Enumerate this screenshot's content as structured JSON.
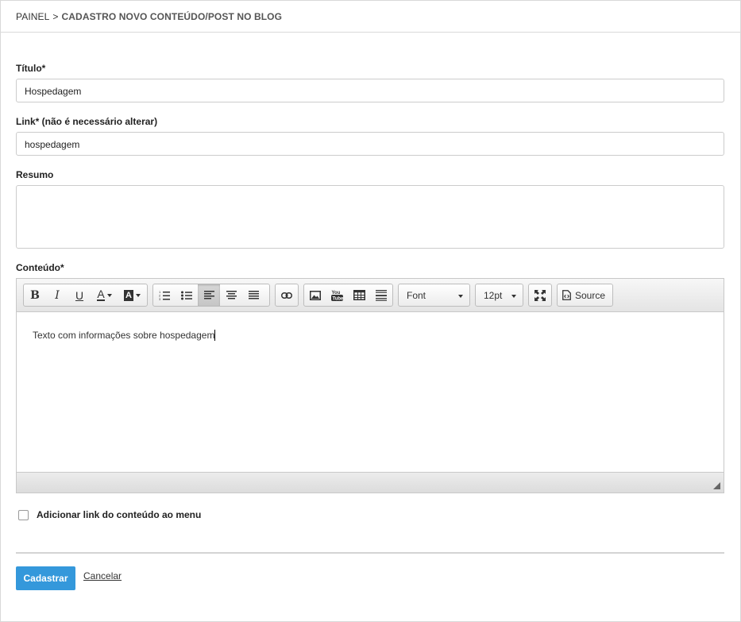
{
  "breadcrumb": {
    "root": "PAINEL",
    "separator": ">",
    "current": "CADASTRO NOVO CONTEÚDO/POST NO BLOG"
  },
  "form": {
    "title_label": "Título*",
    "title_value": "Hospedagem",
    "link_label": "Link* (não é necessário alterar)",
    "link_value": "hospedagem",
    "summary_label": "Resumo",
    "summary_value": "",
    "content_label": "Conteúdo*",
    "content_value": "Texto com informações sobre hospedagem",
    "menu_checkbox_label": "Adicionar link do conteúdo ao menu",
    "menu_checkbox_checked": false,
    "submit_label": "Cadastrar",
    "cancel_label": "Cancelar"
  },
  "editor": {
    "font_dropdown": "Font",
    "size_dropdown": "12pt",
    "source_label": "Source",
    "toolbar_icons": [
      "bold-icon",
      "italic-icon",
      "underline-icon",
      "font-color-icon",
      "background-color-icon",
      "ordered-list-icon",
      "unordered-list-icon",
      "align-left-icon",
      "align-center-icon",
      "justify-icon",
      "link-icon",
      "image-icon",
      "youtube-icon",
      "table-icon",
      "horizontal-rule-icon",
      "fullscreen-icon",
      "source-code-icon"
    ],
    "active_alignment": "left"
  },
  "colors": {
    "primary_button": "#3498db",
    "border": "#cccccc"
  }
}
